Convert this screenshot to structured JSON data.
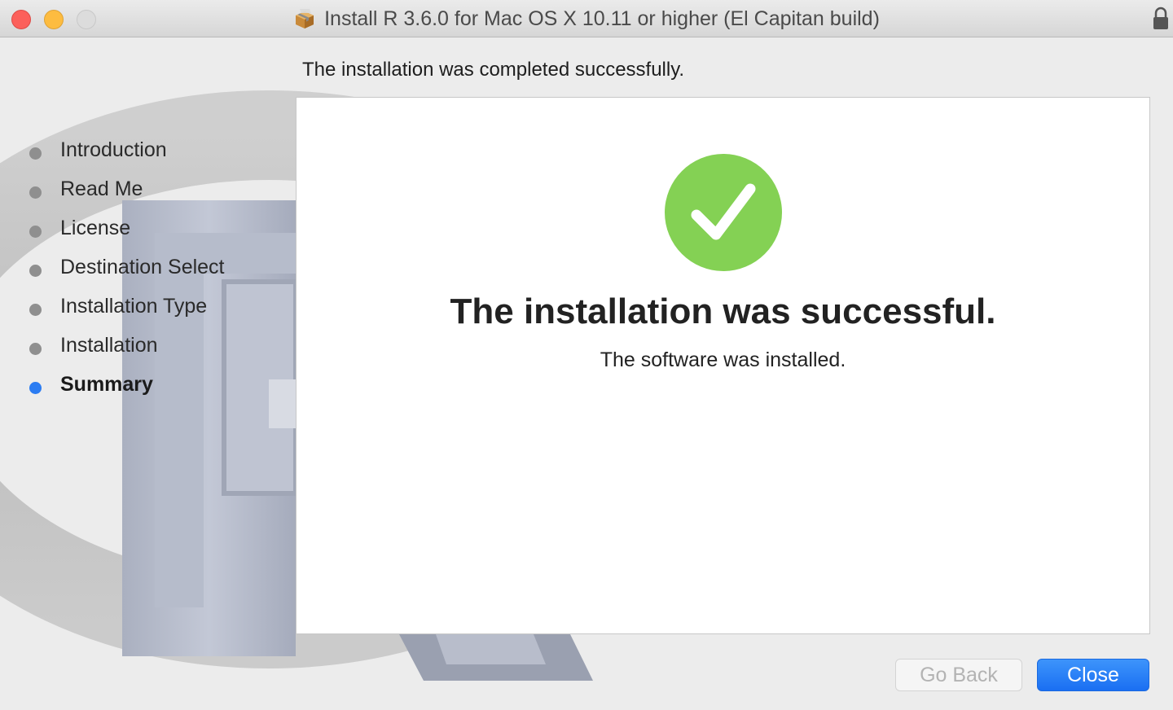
{
  "window": {
    "title": "Install R 3.6.0 for Mac OS X 10.11 or higher (El Capitan build)",
    "title_icon": "package-icon",
    "lock_icon": "lock-icon"
  },
  "header": {
    "message": "The installation was completed successfully."
  },
  "sidebar": {
    "steps": [
      {
        "label": "Introduction",
        "active": false
      },
      {
        "label": "Read Me",
        "active": false
      },
      {
        "label": "License",
        "active": false
      },
      {
        "label": "Destination Select",
        "active": false
      },
      {
        "label": "Installation Type",
        "active": false
      },
      {
        "label": "Installation",
        "active": false
      },
      {
        "label": "Summary",
        "active": true
      }
    ]
  },
  "main": {
    "status_icon": "checkmark-circle-icon",
    "status_color": "#84d154",
    "title": "The installation was successful.",
    "subtitle": "The software was installed."
  },
  "buttons": {
    "go_back": {
      "label": "Go Back",
      "enabled": false
    },
    "close": {
      "label": "Close",
      "enabled": true
    }
  },
  "colors": {
    "accent": "#2b7cf2",
    "success": "#84d154",
    "close_red": "#fc605b",
    "minimize_yellow": "#fdbc40"
  }
}
